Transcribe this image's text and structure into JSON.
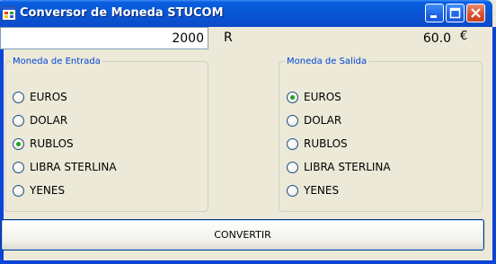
{
  "window": {
    "title": "Conversor de Moneda STUCOM"
  },
  "input": {
    "amount": "2000",
    "currency_symbol": "R"
  },
  "output": {
    "result": "60.0",
    "currency_symbol": "€"
  },
  "input_group": {
    "legend": "Moneda de Entrada",
    "options": [
      {
        "label": "EUROS",
        "checked": false
      },
      {
        "label": "DOLAR",
        "checked": false
      },
      {
        "label": "RUBLOS",
        "checked": true
      },
      {
        "label": "LIBRA STERLINA",
        "checked": false
      },
      {
        "label": "YENES",
        "checked": false
      }
    ]
  },
  "output_group": {
    "legend": "Moneda de Salida",
    "options": [
      {
        "label": "EUROS",
        "checked": true
      },
      {
        "label": "DOLAR",
        "checked": false
      },
      {
        "label": "RUBLOS",
        "checked": false
      },
      {
        "label": "LIBRA STERLINA",
        "checked": false
      },
      {
        "label": "YENES",
        "checked": false
      }
    ]
  },
  "actions": {
    "convert_label": "CONVERTIR"
  }
}
